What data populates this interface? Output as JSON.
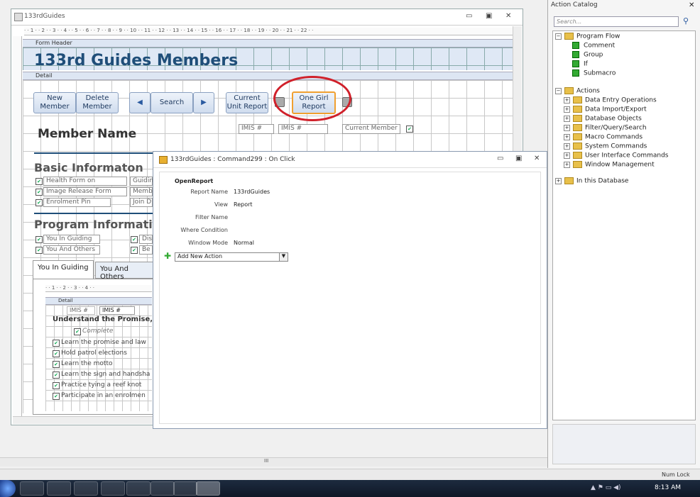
{
  "form_window": {
    "title": "133rdGuides",
    "header_band": "Form Header",
    "detail_band": "Detail",
    "big_title": "133rd Guides Members",
    "buttons": {
      "new_member": "New Member",
      "delete_member": "Delete Member",
      "search": "Search",
      "current_unit_report": "Current Unit Report",
      "one_girl_report": "One Girl Report"
    },
    "member_name": "Member Name",
    "imis_label": "IMIS #",
    "imis_value": "IMIS #",
    "current_member": "Current Member",
    "basic_info": "Basic Informaton",
    "health_form": "Health Form on",
    "image_release": "Image Release Form",
    "enrolment_pin": "Enrolment Pin",
    "guidin": "Guidin",
    "memb": "Memb",
    "join_d": "Join D",
    "program_info": "Program Informatior",
    "you_in_guiding_chk": "You In Guiding",
    "you_and_others_chk": "You And Others",
    "dis": "Dis",
    "be": "Be",
    "tab_you_in_guiding": "You In Guiding",
    "tab_you_and_others": "You And Others",
    "sub_detail": "Detail",
    "sub_imis_label": "IMIS #",
    "sub_imis_value": "IMIS #",
    "sub_heading": "Understand the Promise, I",
    "complete": "Complete",
    "tasks": [
      "Learn the promise and law",
      "Hold patrol elections",
      "Learn the motto",
      "Learn the sign and handsha",
      "Practice tying a reef knot",
      "Participate in an enrolmen"
    ]
  },
  "macro_window": {
    "title": "133rdGuides : Command299 : On Click",
    "action": "OpenReport",
    "report_name_label": "Report Name",
    "report_name_value": "133rdGuides",
    "view_label": "View",
    "view_value": "Report",
    "filter_label": "Filter Name",
    "where_label": "Where Condition",
    "window_mode_label": "Window Mode",
    "window_mode_value": "Normal",
    "add_action": "Add New Action"
  },
  "catalog": {
    "title": "Action Catalog",
    "search_placeholder": "Search...",
    "program_flow": "Program Flow",
    "flow_items": [
      "Comment",
      "Group",
      "If",
      "Submacro"
    ],
    "actions": "Actions",
    "action_groups": [
      "Data Entry Operations",
      "Data Import/Export",
      "Database Objects",
      "Filter/Query/Search",
      "Macro Commands",
      "System Commands",
      "User Interface Commands",
      "Window Management"
    ],
    "in_database": "In this Database"
  },
  "status": {
    "num_lock": "Num Lock",
    "scroll_mark": "III"
  },
  "taskbar": {
    "clock": "8:13 AM"
  },
  "colors": {
    "highlight_oval": "#d0202a",
    "title_blue": "#1f4e79"
  }
}
